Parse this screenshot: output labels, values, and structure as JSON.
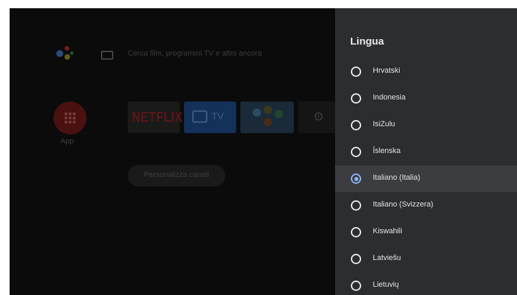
{
  "colors": {
    "screen_bg": "#050505",
    "panel_bg": "#2c2d30",
    "selected_row_bg": "#3c3d40",
    "radio_accent": "#8ab4f8",
    "text_primary": "#e8e8e8"
  },
  "home": {
    "search_placeholder": "Cerca film, programmi TV e altro ancora",
    "apps_label": "App",
    "tiles": [
      {
        "name": "netflix",
        "label": "NETFLIX"
      },
      {
        "name": "live-tv",
        "label": "TV"
      },
      {
        "name": "video-app",
        "label": ""
      },
      {
        "name": "settings",
        "label": ""
      }
    ],
    "customize_channels": "Personalizza canali",
    "icons": [
      "google-assistant-icon",
      "keyboard-icon",
      "apps-grid-icon",
      "tv-icon",
      "gear-icon"
    ]
  },
  "panel": {
    "title": "Lingua",
    "languages": [
      {
        "label": "Hrvatski",
        "selected": false
      },
      {
        "label": "Indonesia",
        "selected": false
      },
      {
        "label": "IsiZulu",
        "selected": false
      },
      {
        "label": "Íslenska",
        "selected": false
      },
      {
        "label": "Italiano (Italia)",
        "selected": true
      },
      {
        "label": "Italiano (Svizzera)",
        "selected": false
      },
      {
        "label": "Kiswahili",
        "selected": false
      },
      {
        "label": "Latviešu",
        "selected": false
      },
      {
        "label": "Lietuvių",
        "selected": false
      }
    ]
  }
}
